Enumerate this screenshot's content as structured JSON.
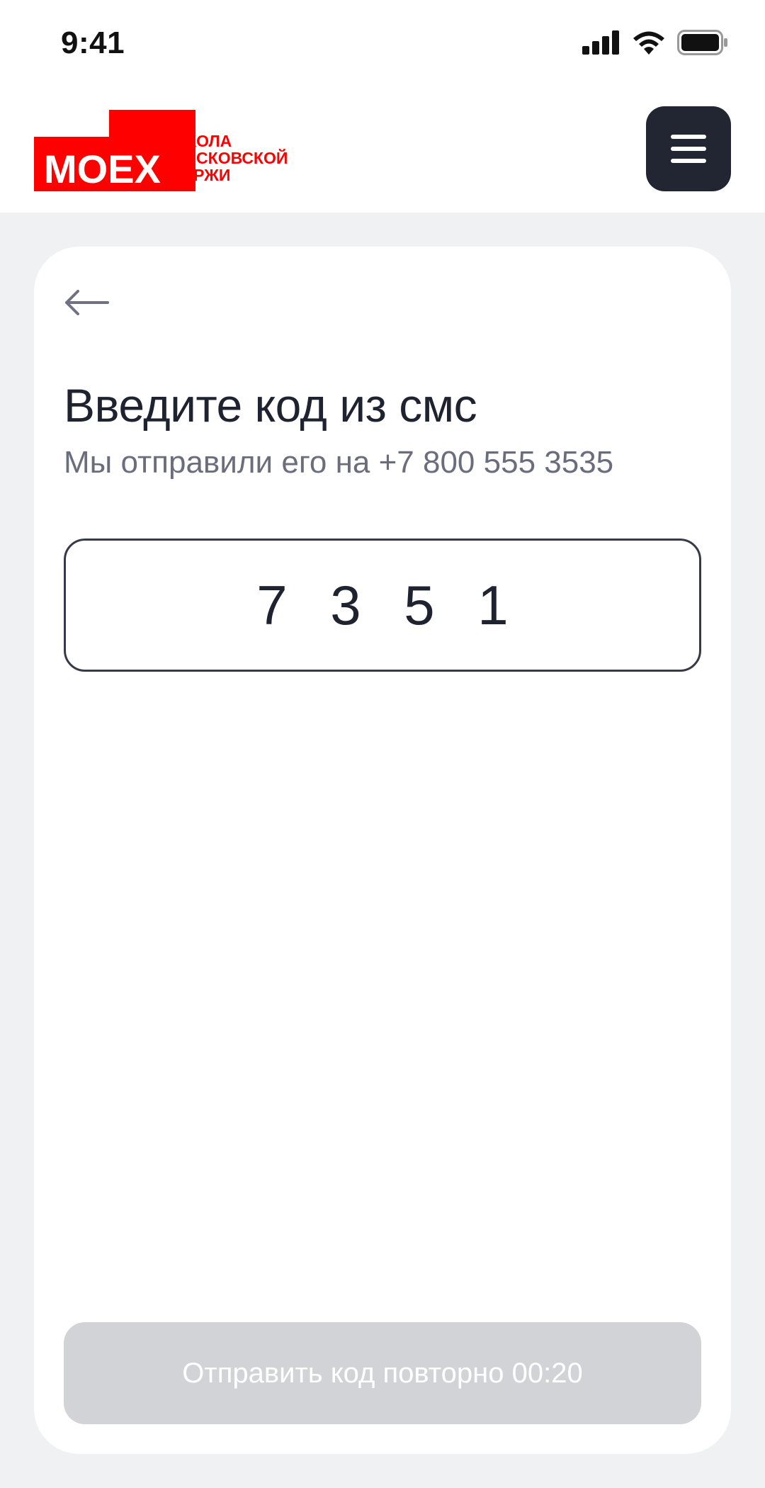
{
  "status_bar": {
    "time": "9:41",
    "icons": [
      "cellular-signal-icon",
      "wifi-icon",
      "battery-icon"
    ]
  },
  "header": {
    "logo": {
      "brand": "MOEX",
      "lines": [
        "ШКОЛА",
        "МОСКОВСКОЙ",
        "БИРЖИ"
      ]
    },
    "menu_icon": "hamburger-menu-icon"
  },
  "card": {
    "back_icon": "arrow-left-icon",
    "title": "Введите код из смс",
    "subtitle": "Мы отправили его на +7 800 555 3535",
    "code_digits": [
      "7",
      "3",
      "5",
      "1"
    ],
    "resend_label": "Отправить код повторно 00:20"
  },
  "colors": {
    "brand_red": "#ff0000",
    "dark": "#222633",
    "page_bg": "#f0f1f3",
    "disabled_button": "#d2d3d6",
    "muted_text": "#6a6d7c"
  }
}
